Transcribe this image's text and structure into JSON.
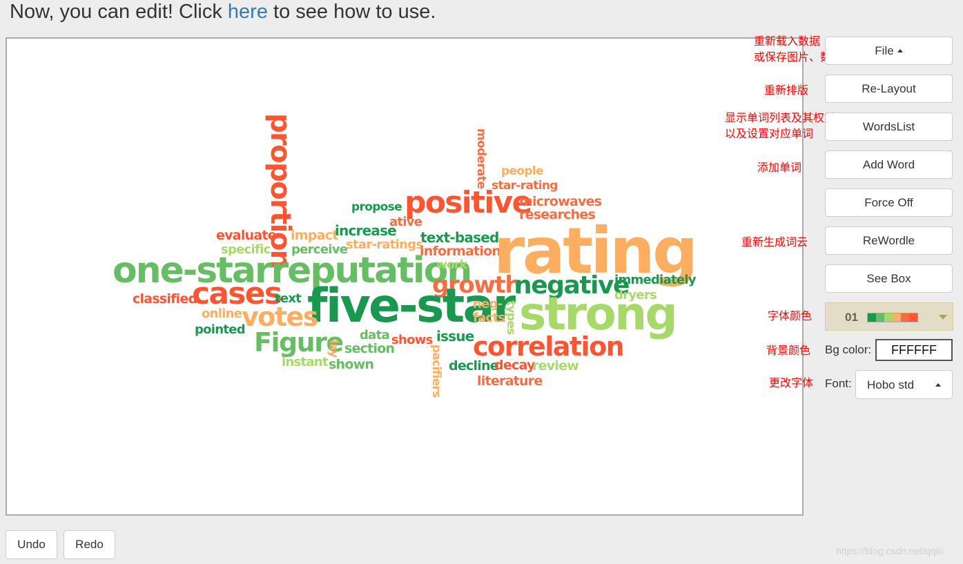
{
  "header": {
    "prefix": "Now, you can edit! Click ",
    "link": "here",
    "suffix": " to see how to use."
  },
  "palette_colors": [
    "#1a9850",
    "#66bd63",
    "#a6d96a",
    "#fdae61",
    "#f46d43",
    "#ff5533"
  ],
  "words": [
    {
      "text": "proportion",
      "color": "#ff5533"
    },
    {
      "text": "moderate",
      "color": "#f46d43"
    },
    {
      "text": "people",
      "color": "#fdae61"
    },
    {
      "text": "star-rating",
      "color": "#f46d43"
    },
    {
      "text": "propose",
      "color": "#1a9850"
    },
    {
      "text": "positive",
      "color": "#ff5533"
    },
    {
      "text": "microwaves",
      "color": "#f46d43"
    },
    {
      "text": "researches",
      "color": "#f46d43"
    },
    {
      "text": "ative",
      "color": "#f46d43"
    },
    {
      "text": "evaluate",
      "color": "#ff5533"
    },
    {
      "text": "impact",
      "color": "#fdae61"
    },
    {
      "text": "increase",
      "color": "#1a9850"
    },
    {
      "text": "text-based",
      "color": "#1a9850"
    },
    {
      "text": "star-ratings",
      "color": "#fdae61"
    },
    {
      "text": "specific",
      "color": "#a6d96a"
    },
    {
      "text": "perceive",
      "color": "#66bd63"
    },
    {
      "text": "information",
      "color": "#f46d43"
    },
    {
      "text": "rating",
      "color": "#fdae61"
    },
    {
      "text": "one-starreputation",
      "color": "#66bd63"
    },
    {
      "text": "work",
      "color": "#a6d96a"
    },
    {
      "text": "growth",
      "color": "#f46d43"
    },
    {
      "text": "negative",
      "color": "#1a9850"
    },
    {
      "text": "immediately",
      "color": "#1a9850"
    },
    {
      "text": "dryers",
      "color": "#a6d96a"
    },
    {
      "text": "classified",
      "color": "#ff5533"
    },
    {
      "text": "cases",
      "color": "#ff5533"
    },
    {
      "text": "text",
      "color": "#1a9850"
    },
    {
      "text": "five-star",
      "color": "#1a9850"
    },
    {
      "text": "neg-",
      "color": "#fdae61"
    },
    {
      "text": "facts",
      "color": "#fdae61"
    },
    {
      "text": "types",
      "color": "#a6d96a"
    },
    {
      "text": "strong",
      "color": "#a6d96a"
    },
    {
      "text": "online",
      "color": "#fdae61"
    },
    {
      "text": "votes",
      "color": "#fdae61"
    },
    {
      "text": "pointed",
      "color": "#1a9850"
    },
    {
      "text": "data",
      "color": "#66bd63"
    },
    {
      "text": "shows",
      "color": "#ff5533"
    },
    {
      "text": "issue",
      "color": "#1a9850"
    },
    {
      "text": "Figure",
      "color": "#66bd63"
    },
    {
      "text": "lay",
      "color": "#fdae61"
    },
    {
      "text": "section",
      "color": "#66bd63"
    },
    {
      "text": "correlation",
      "color": "#ff5533"
    },
    {
      "text": "pacifiers",
      "color": "#fdae61"
    },
    {
      "text": "instant",
      "color": "#a6d96a"
    },
    {
      "text": "shown",
      "color": "#66bd63"
    },
    {
      "text": "decline",
      "color": "#1a9850"
    },
    {
      "text": "decay",
      "color": "#ff5533"
    },
    {
      "text": "review",
      "color": "#a6d96a"
    },
    {
      "text": "literature",
      "color": "#f46d43"
    }
  ],
  "panel": {
    "file": "File",
    "relayout": "Re-Layout",
    "wordslist": "WordsList",
    "add_word": "Add Word",
    "force": "Force Off",
    "rewordle": "ReWordle",
    "see_box": "See Box",
    "palette_label": "01",
    "bg_label": "Bg color:",
    "bg_value": "FFFFFF",
    "font_label": "Font:",
    "font_value": "Hobo std"
  },
  "notes": {
    "file1": "重新载入数据",
    "file2": "或保存图片、数据",
    "relayout": "重新排版",
    "words1": "显示单词列表及其权重",
    "words2": "以及设置对应单词",
    "add": "添加单词",
    "rewordle": "重新生成词云",
    "color": "字体颜色",
    "bg": "背景颜色",
    "font": "更改字体"
  },
  "footer": {
    "undo": "Undo",
    "redo": "Redo",
    "watermark": "https://blog.csdn.net/qqiri"
  }
}
